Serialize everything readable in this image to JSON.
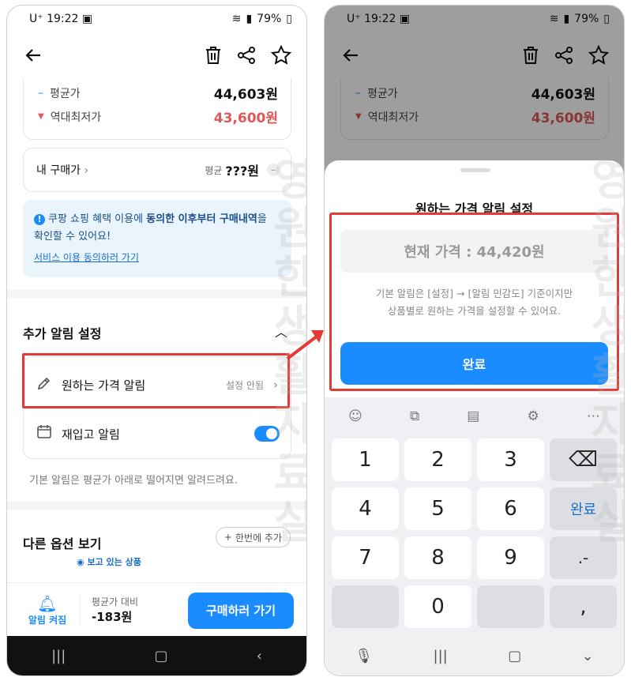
{
  "status": {
    "carrier": "U⁺",
    "time": "19:22",
    "battery": "79%"
  },
  "left": {
    "avg_label": "평균가",
    "avg_value": "44,603원",
    "low_label": "역대최저가",
    "low_value": "43,600원",
    "mybuy_label": "내 구매가",
    "mybuy_avg": "평균",
    "mybuy_value": "???원",
    "info_line1a": "쿠팡 쇼핑 혜택 이용에 ",
    "info_line1b": "동의한 이후부터 구매내역",
    "info_line1c": "을",
    "info_line2": "확인할 수 있어요!",
    "info_link": "서비스 이용 동의하러 가기",
    "extra_title": "추가 알림 설정",
    "price_alert": "원하는 가격 알림",
    "price_alert_status": "설정 안됨",
    "restock": "재입고 알림",
    "note": "기본 알림은 평균가 아래로 떨어지면 알려드려요.",
    "options_title": "다른 옵션 보기",
    "add_btn": "한번에 추가",
    "viewing": "보고 있는 상품",
    "bell_label": "알림 켜짐",
    "diff_label": "평균가 대비",
    "diff_value": "-183원",
    "buy_btn": "구매하러 가기"
  },
  "right": {
    "sheet_title": "원하는 가격 알림 설정",
    "input_placeholder": "현재 가격 : 44,420원",
    "hint1": "기본 알림은 [설정] → [알림 민감도] 기준이지만",
    "hint2": "상품별로 원하는 가격을 설정할 수 있어요.",
    "done_btn": "완료",
    "keys": [
      "1",
      "2",
      "3",
      "4",
      "5",
      "6",
      "7",
      "8",
      "9",
      "0",
      ".-",
      ",",
      "완료"
    ]
  },
  "watermark": "영원한생활자료실",
  "colors": {
    "accent": "#1a8cff",
    "red": "#e05757",
    "highlight": "#e53935"
  }
}
